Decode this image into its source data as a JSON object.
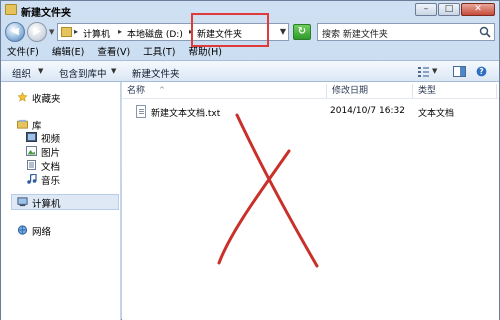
{
  "window": {
    "title": "新建文件夹",
    "buttons": {
      "minimize": "–",
      "maximize": "□",
      "close": "✕"
    }
  },
  "address": {
    "crumbs": [
      "计算机",
      "本地磁盘 (D:)",
      "新建文件夹"
    ],
    "separator": "▸",
    "search_placeholder": "搜索 新建文件夹"
  },
  "menu": [
    "文件(F)",
    "编辑(E)",
    "查看(V)",
    "工具(T)",
    "帮助(H)"
  ],
  "commands": {
    "organize": "组织",
    "include_library": "包含到库中",
    "new_folder": "新建文件夹"
  },
  "nav": {
    "favorites": "收藏夹",
    "libraries": "库",
    "library_items": [
      "视频",
      "图片",
      "文档",
      "音乐"
    ],
    "computer": "计算机",
    "network": "网络"
  },
  "columns": {
    "name": "名称",
    "date": "修改日期",
    "type": "类型"
  },
  "files": [
    {
      "name": "新建文本文档.txt",
      "date": "2014/10/7 16:32",
      "type": "文本文档"
    }
  ],
  "colors": {
    "highlight": "#e03a3a",
    "cross_mark": "#c9302a"
  },
  "icons": [
    "back-icon",
    "forward-icon",
    "folder-icon",
    "refresh-icon",
    "search-icon",
    "star-icon",
    "library-icon",
    "video-icon",
    "picture-icon",
    "document-icon",
    "music-icon",
    "computer-icon",
    "network-icon",
    "text-file-icon",
    "views-icon",
    "preview-pane-icon",
    "help-icon"
  ]
}
